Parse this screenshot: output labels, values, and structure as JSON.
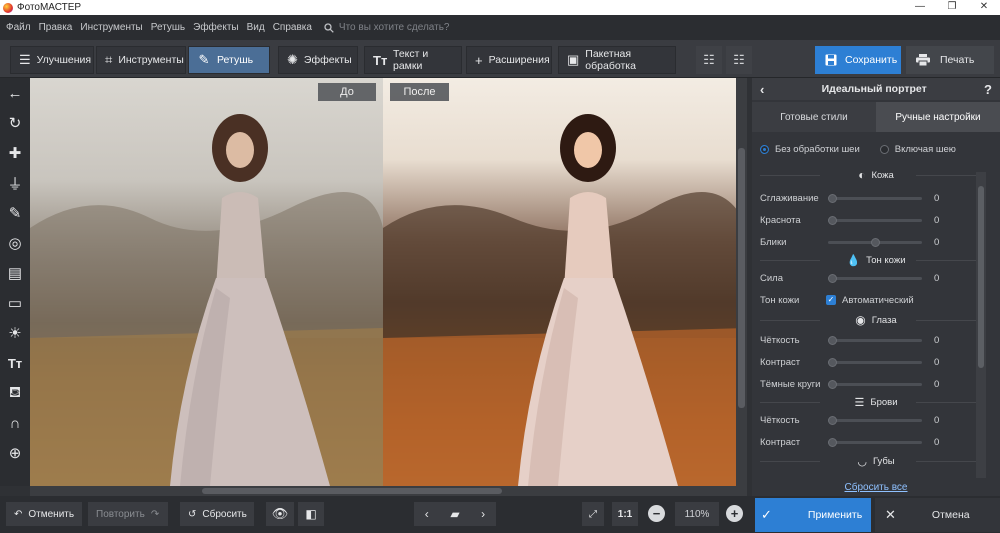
{
  "window": {
    "title": "ФотоМАСТЕР",
    "controls": [
      "—",
      "❐",
      "✕"
    ]
  },
  "menu": {
    "items": [
      "Файл",
      "Правка",
      "Инструменты",
      "Ретушь",
      "Эффекты",
      "Вид",
      "Справка"
    ],
    "search_placeholder": "Что вы хотите сделать?"
  },
  "toolbar": {
    "tabs": [
      {
        "label": "Улучшения",
        "icon": "sliders-icon"
      },
      {
        "label": "Инструменты",
        "icon": "crop-icon"
      },
      {
        "label": "Ретушь",
        "icon": "brush-icon",
        "active": true
      },
      {
        "label": "Эффекты",
        "icon": "sparkle-icon"
      },
      {
        "label": "Текст и рамки",
        "icon": "text-icon"
      },
      {
        "label": "Расширения",
        "icon": "plus-icon"
      },
      {
        "label": "Пакетная обработка",
        "icon": "batch-icon"
      }
    ],
    "save_label": "Сохранить",
    "print_label": "Печать"
  },
  "canvas": {
    "before_label": "До",
    "after_label": "После"
  },
  "panel": {
    "title": "Идеальный портрет",
    "help": "?",
    "tabs": [
      {
        "label": "Готовые стили"
      },
      {
        "label": "Ручные настройки",
        "active": true
      }
    ],
    "radios": [
      {
        "label": "Без обработки шеи",
        "checked": true
      },
      {
        "label": "Включая шею",
        "checked": false
      }
    ],
    "sections": {
      "skin": "Кожа",
      "skin_tone": "Тон кожи",
      "eyes": "Глаза",
      "brows": "Брови",
      "lips": "Губы"
    },
    "sliders": {
      "smoothing": {
        "label": "Сглаживание",
        "value": "0"
      },
      "redness": {
        "label": "Краснота",
        "value": "0"
      },
      "glare": {
        "label": "Блики",
        "value": "0"
      },
      "strength": {
        "label": "Сила",
        "value": "0"
      },
      "eye_clarity": {
        "label": "Чёткость",
        "value": "0"
      },
      "eye_contrast": {
        "label": "Контраст",
        "value": "0"
      },
      "dark_circles": {
        "label": "Тёмные круги",
        "value": "0"
      },
      "brow_clarity": {
        "label": "Чёткость",
        "value": "0"
      },
      "brow_contrast": {
        "label": "Контраст",
        "value": "0"
      }
    },
    "skin_tone_row": {
      "label": "Тон кожи",
      "checkbox_label": "Автоматический",
      "checked": true
    },
    "reset_all": "Сбросить все"
  },
  "bottom": {
    "undo": "Отменить",
    "redo": "Повторить",
    "reset": "Сбросить",
    "one_to_one": "1:1",
    "zoom": "110%",
    "apply": "Применить",
    "cancel": "Отмена"
  },
  "colors": {
    "accent": "#2d7fd4",
    "active_tab": "#4b6e96",
    "bg": "#2f3135"
  }
}
